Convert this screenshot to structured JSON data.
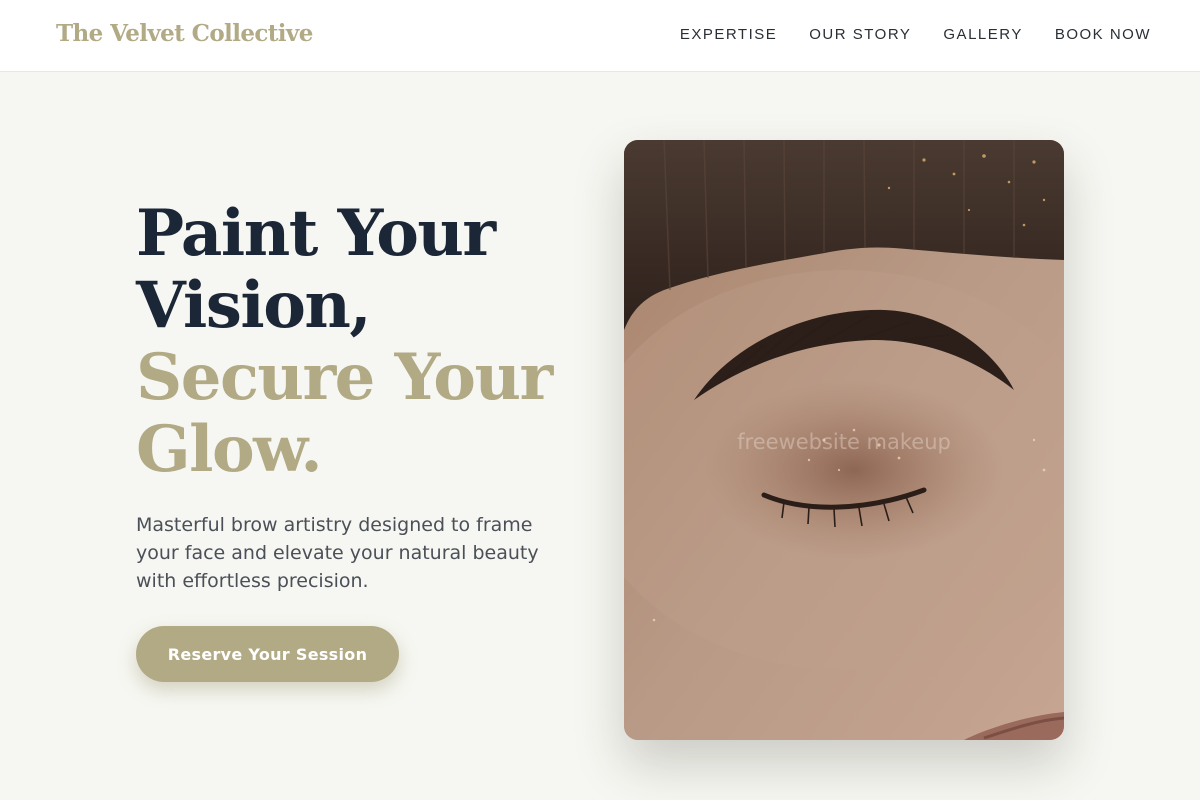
{
  "header": {
    "logo": "The Velvet Collective",
    "nav": [
      "EXPERTISE",
      "OUR STORY",
      "GALLERY",
      "BOOK NOW"
    ]
  },
  "hero": {
    "headline_dark": [
      "Paint Your",
      "Vision,"
    ],
    "headline_accent": [
      "Secure Your",
      "Glow."
    ],
    "description": "Masterful brow artistry designed to frame your face and elevate your natural beauty with effortless precision.",
    "cta_label": "Reserve Your Session"
  },
  "image": {
    "subject": "close-up of closed eye with brow and bangs",
    "watermark": "freewebsite makeup"
  },
  "colors": {
    "accent": "#b1aa85",
    "heading": "#1b2637",
    "background": "#f6f7f2"
  }
}
